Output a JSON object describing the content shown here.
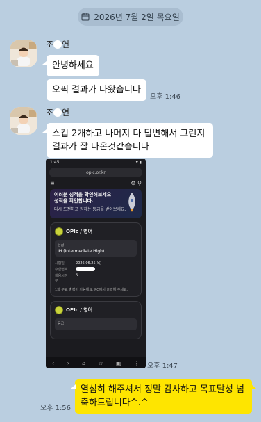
{
  "date_divider": {
    "text": "2026년 7월 2일 목요일",
    "icon": "calendar-icon"
  },
  "messages": [
    {
      "sender": {
        "first": "조",
        "last": "연"
      },
      "text": "안녕하세요"
    },
    {
      "text": "오픽 결과가 나왔습니다",
      "time": "오후 1:46"
    },
    {
      "sender": {
        "first": "조",
        "last": "연"
      },
      "lines": [
        "스킵 2개하고 나머지 다 답변해서 그런지",
        " 결과가 잘 나온것같습니다"
      ]
    },
    {
      "image": {
        "status_time": "1:45",
        "url": "opic.or.kr",
        "banner_line1": "여러분 성적을 확인해보세요",
        "banner_line2": "성적을 확인합니다.",
        "banner_line3": "다시 도전하고 원하는 등급을 받아보세요.",
        "card_title": "OPIc / 영어",
        "grade_label": "등급",
        "grade_value": "IH (Intermediate High)",
        "exam_date_label": "시험일",
        "exam_date_value": "2026.06.25(목)",
        "exam_no_label": "수험번호",
        "retest_label": "재응시여부",
        "retest_value": "N",
        "note": "1회 무료 출력이 가능해요. PC에서 출력해 주세요.",
        "card2_title": "OPIc / 영어",
        "card2_grade_label": "등급"
      },
      "time": "오후 1:47"
    },
    {
      "mine": true,
      "lines": [
        "열심히 해주셔서 정말 감사하고 목표달성 넘",
        "축하드립니다^.^"
      ],
      "time": "오후 1:56"
    }
  ]
}
